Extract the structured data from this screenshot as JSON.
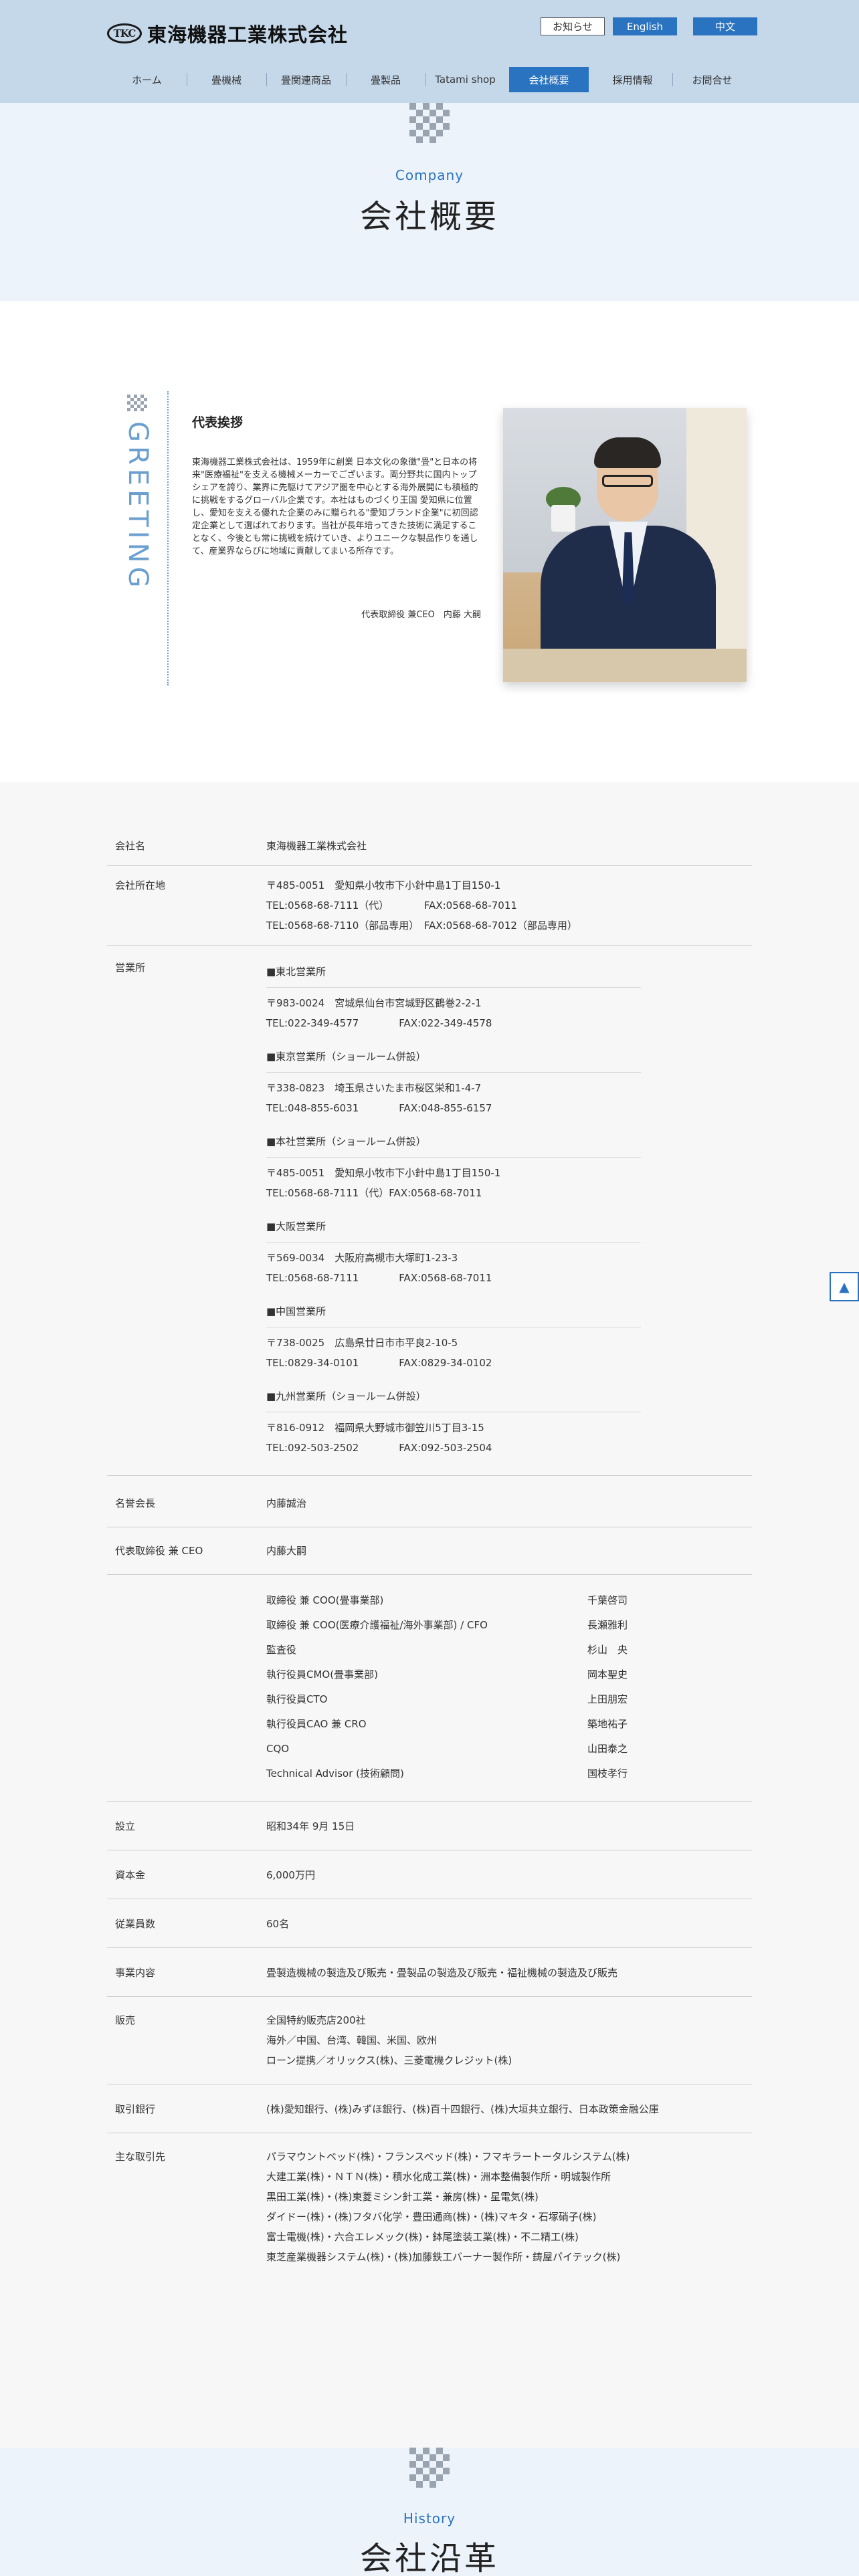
{
  "header": {
    "logo_badge": "TKC",
    "logo_text": "東海機器工業株式会社",
    "lang_news": "お知らせ",
    "lang_en": "English",
    "lang_cn": "中文",
    "nav": [
      "ホーム",
      "畳機械",
      "畳関連商品",
      "畳製品",
      "Tatami shop",
      "会社概要",
      "採用情報",
      "お問合せ"
    ],
    "active_index": 5
  },
  "title_section": {
    "en": "Company",
    "ja": "会社概要"
  },
  "greeting": {
    "vertical_label": "GREETING",
    "title": "代表挨拶",
    "body": "東海機器工業株式会社は、1959年に創業 日本文化の象徴\"畳\"と日本の将来\"医療福祉\"を支える機械メーカーでございます。両分野共に国内トップシェアを誇り、業界に先駆けてアジア圏を中心とする海外展開にも積極的に挑戦をするグローバル企業です。本社はものづくり王国 愛知県に位置し、愛知を支える優れた企業のみに贈られる\"愛知ブランド企業\"に初回認定企業として選ばれております。当社が長年培ってきた技術に満足することなく、今後とも常に挑戦を続けていき、よりユニークな製品作りを通して、産業界ならびに地域に貢献してまいる所存です。",
    "signature": "代表取締役 兼CEO　内藤 大嗣"
  },
  "company": {
    "name_label": "会社名",
    "name": "東海機器工業株式会社",
    "address_label": "会社所在地",
    "address_lines": [
      "〒485-0051　愛知県小牧市下小針中島1丁目150-1",
      "TEL:0568-68-7111（代）　　　　FAX:0568-68-7011",
      "TEL:0568-68-7110（部品専用）　FAX:0568-68-7012（部品専用）"
    ],
    "offices_label": "営業所",
    "offices": [
      {
        "name": "■東北営業所",
        "lines": [
          "〒983-0024　宮城県仙台市宮城野区鶴巻2-2-1",
          "TEL:022-349-4577　　　　FAX:022-349-4578"
        ]
      },
      {
        "name": "■東京営業所（ショールーム併設）",
        "lines": [
          "〒338-0823　埼玉県さいたま市桜区栄和1-4-7",
          "TEL:048-855-6031　　　　FAX:048-855-6157"
        ]
      },
      {
        "name": "■本社営業所（ショールーム併設）",
        "lines": [
          "〒485-0051　愛知県小牧市下小針中島1丁目150-1",
          "TEL:0568-68-7111（代）FAX:0568-68-7011"
        ]
      },
      {
        "name": "■大阪営業所",
        "lines": [
          "〒569-0034　大阪府高槻市大塚町1-23-3",
          "TEL:0568-68-7111　　　　FAX:0568-68-7011"
        ]
      },
      {
        "name": "■中国営業所",
        "lines": [
          "〒738-0025　広島県廿日市市平良2-10-5",
          "TEL:0829-34-0101　　　　FAX:0829-34-0102"
        ]
      },
      {
        "name": "■九州営業所（ショールーム併設）",
        "lines": [
          "〒816-0912　福岡県大野城市御笠川5丁目3-15",
          "TEL:092-503-2502　　　　FAX:092-503-2504"
        ]
      }
    ],
    "honorary_label": "名誉会長",
    "honorary": "内藤誠治",
    "ceo_label": "代表取締役 兼 CEO",
    "ceo": "内藤大嗣",
    "officers": [
      {
        "role": "取締役 兼 COO(畳事業部)",
        "name": "千葉啓司"
      },
      {
        "role": "取締役 兼 COO(医療介護福祉/海外事業部) / CFO",
        "name": "長瀬雅利"
      },
      {
        "role": "監査役",
        "name": "杉山　央"
      },
      {
        "role": "執行役員CMO(畳事業部)",
        "name": "岡本聖史"
      },
      {
        "role": "執行役員CTO",
        "name": "上田朋宏"
      },
      {
        "role": "執行役員CAO 兼 CRO",
        "name": "築地祐子"
      },
      {
        "role": "CQO",
        "name": "山田泰之"
      },
      {
        "role": "Technical Advisor (技術顧問)",
        "name": "国枝孝行"
      }
    ],
    "founded_label": "設立",
    "founded": "昭和34年 9月 15日",
    "capital_label": "資本金",
    "capital": "6,000万円",
    "employees_label": "従業員数",
    "employees": "60名",
    "business_label": "事業内容",
    "business": "畳製造機械の製造及び販売・畳製品の製造及び販売・福祉機械の製造及び販売",
    "sales_label": "販売",
    "sales_lines": [
      "全国特約販売店200社",
      "海外／中国、台湾、韓国、米国、欧州",
      "ローン提携／オリックス(株)、三菱電機クレジット(株)"
    ],
    "banks_label": "取引銀行",
    "banks": "(株)愛知銀行、(株)みずほ銀行、(株)百十四銀行、(株)大垣共立銀行、日本政策金融公庫",
    "partners_label": "主な取引先",
    "partners_lines": [
      "パラマウントベッド(株)・フランスベッド(株)・フマキラートータルシステム(株)",
      "大建工業(株)・ＮＴＮ(株)・積水化成工業(株)・洲本整備製作所・明城製作所",
      "黒田工業(株)・(株)東菱ミシン針工業・兼房(株)・星電気(株)",
      "ダイドー(株)・(株)フタバ化学・豊田通商(株)・(株)マキタ・石塚硝子(株)",
      "富士電機(株)・六合エレメック(株)・鉢尾塗装工業(株)・不二精工(株)",
      "東芝産業機器システム(株)・(株)加藤鉄工バーナー製作所・鋳屋パイテック(株)"
    ]
  },
  "history_section": {
    "en": "History",
    "ja": "会社沿革"
  },
  "page_top_label": "▲"
}
